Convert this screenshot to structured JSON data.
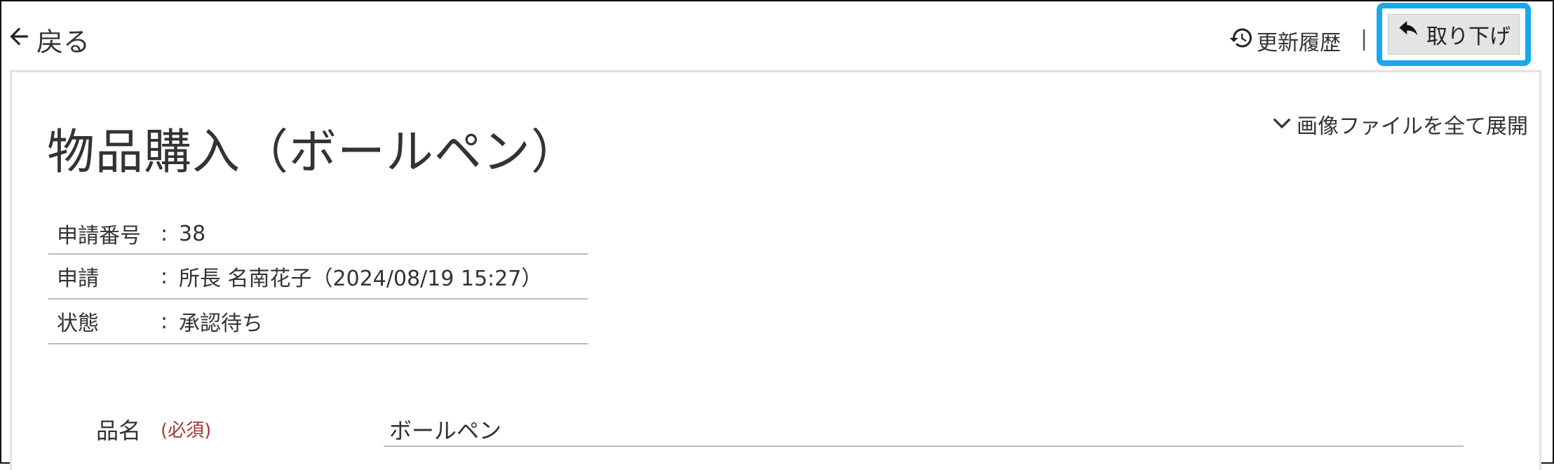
{
  "header": {
    "back_label": "戻る",
    "history_label": "更新履歴",
    "separator": "|",
    "withdraw_label": "取り下げ"
  },
  "page": {
    "title": "物品購入（ボールペン）",
    "expand_all_label": "画像ファイルを全て展開"
  },
  "meta": [
    {
      "label": "申請番号",
      "colon": ":",
      "value": "38"
    },
    {
      "label": "申請",
      "colon": ":",
      "value": "所長  名南花子（2024/08/19 15:27）"
    },
    {
      "label": "状態",
      "colon": ":",
      "value": "承認待ち"
    }
  ],
  "form": {
    "item_name_label": "品名",
    "item_name_required": "(必須)",
    "item_name_value": "ボールペン"
  },
  "colors": {
    "highlight": "#17a8ef",
    "required": "#a23a32",
    "button_bg": "#e4e4e4"
  },
  "icons": {
    "back": "arrow-left-icon",
    "history": "history-icon",
    "withdraw": "undo-arrow-icon",
    "expand": "chevron-down-icon"
  }
}
